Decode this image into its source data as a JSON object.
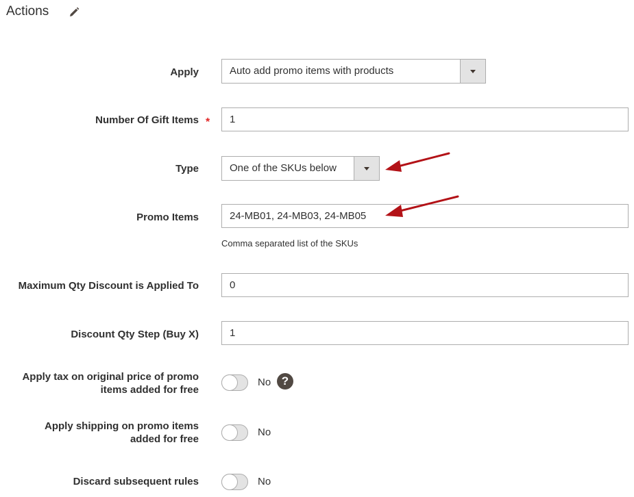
{
  "section": {
    "title": "Actions"
  },
  "fields": {
    "apply": {
      "label": "Apply",
      "value": "Auto add promo items with products"
    },
    "gift_items": {
      "label": "Number Of Gift Items",
      "required_mark": "*",
      "value": "1"
    },
    "type": {
      "label": "Type",
      "value": "One of the SKUs below"
    },
    "promo_items": {
      "label": "Promo Items",
      "value": "24-MB01, 24-MB03, 24-MB05",
      "note": "Comma separated list of the SKUs"
    },
    "max_qty": {
      "label": "Maximum Qty Discount is Applied To",
      "value": "0"
    },
    "qty_step": {
      "label": "Discount Qty Step (Buy X)",
      "value": "1"
    },
    "apply_tax": {
      "label_line1": "Apply tax on original price of promo",
      "label_line2": "items added for free",
      "state": "No",
      "checked": false
    },
    "apply_shipping": {
      "label_line1": "Apply shipping on promo items",
      "label_line2": "added for free",
      "state": "No",
      "checked": false
    },
    "discard_rules": {
      "label": "Discard subsequent rules",
      "state": "No",
      "checked": false
    }
  },
  "icons": {
    "edit": "pencil-icon",
    "help": "help-icon",
    "dropdown": "chevron-down-icon",
    "arrows": "red-arrow-icon"
  },
  "help_glyph": "?",
  "colors": {
    "text": "#303030",
    "required": "#e22626",
    "border": "#adadad",
    "arrow": "#b31217"
  }
}
